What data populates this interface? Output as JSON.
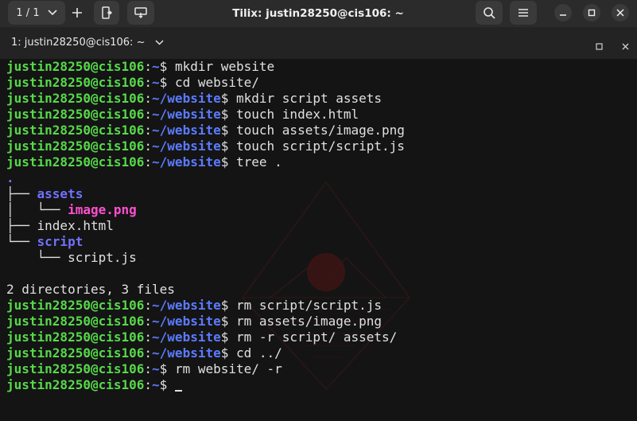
{
  "titlebar": {
    "session_counter": "1 / 1",
    "title": "Tilix: justin28250@cis106: ~"
  },
  "tab": {
    "label": "1: justin28250@cis106: ~"
  },
  "terminal": {
    "user": "justin28250@cis106",
    "lines": [
      {
        "type": "prompt",
        "path": "~",
        "cmd": "mkdir website"
      },
      {
        "type": "prompt",
        "path": "~",
        "cmd": "cd website/"
      },
      {
        "type": "prompt",
        "path": "~/website",
        "cmd": "mkdir script assets"
      },
      {
        "type": "prompt",
        "path": "~/website",
        "cmd": "touch index.html"
      },
      {
        "type": "prompt",
        "path": "~/website",
        "cmd": "touch assets/image.png"
      },
      {
        "type": "prompt",
        "path": "~/website",
        "cmd": "touch script/script.js"
      },
      {
        "type": "prompt",
        "path": "~/website",
        "cmd": "tree ."
      },
      {
        "type": "tree",
        "prefix": "",
        "name": ".",
        "kind": "dir"
      },
      {
        "type": "tree",
        "prefix": "├── ",
        "name": "assets",
        "kind": "dir"
      },
      {
        "type": "tree",
        "prefix": "│   └── ",
        "name": "image.png",
        "kind": "image"
      },
      {
        "type": "tree",
        "prefix": "├── ",
        "name": "index.html",
        "kind": "file"
      },
      {
        "type": "tree",
        "prefix": "└── ",
        "name": "script",
        "kind": "dir"
      },
      {
        "type": "tree",
        "prefix": "    └── ",
        "name": "script.js",
        "kind": "file"
      },
      {
        "type": "text",
        "text": ""
      },
      {
        "type": "text",
        "text": "2 directories, 3 files"
      },
      {
        "type": "prompt",
        "path": "~/website",
        "cmd": "rm script/script.js"
      },
      {
        "type": "prompt",
        "path": "~/website",
        "cmd": "rm assets/image.png"
      },
      {
        "type": "prompt",
        "path": "~/website",
        "cmd": "rm -r script/ assets/"
      },
      {
        "type": "prompt",
        "path": "~/website",
        "cmd": "cd ../"
      },
      {
        "type": "prompt",
        "path": "~",
        "cmd": "rm website/ -r"
      },
      {
        "type": "prompt",
        "path": "~",
        "cmd": "",
        "cursor": true
      }
    ]
  }
}
